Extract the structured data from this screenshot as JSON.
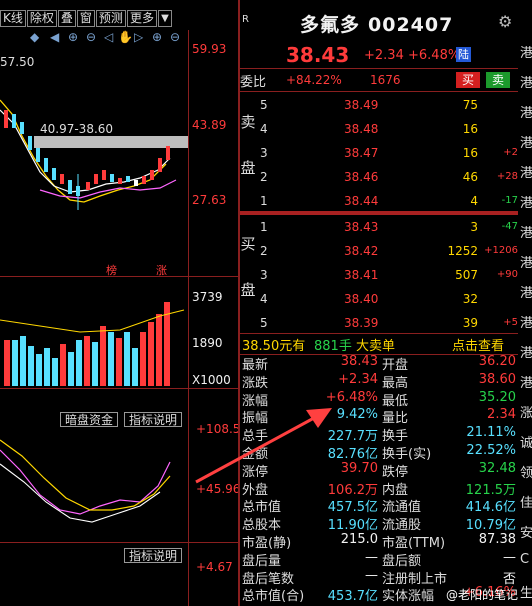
{
  "toolbar": {
    "tabs": [
      "K线",
      "除权",
      "叠",
      "窗",
      "预测",
      "更多"
    ],
    "dropdown": "▼"
  },
  "chart": {
    "price_label_top": "57.50",
    "range_note": "40.97-38.60",
    "axis_labels": [
      "59.93",
      "43.89",
      "27.63",
      "3739",
      "1890",
      "X1000",
      "+108.5",
      "+45.96",
      "+4.67"
    ],
    "tags": [
      "榜",
      "涨"
    ],
    "btn_dark_pool": "暗盘资金",
    "btn_indicator": "指标说明",
    "btn_indicator2": "指标说明"
  },
  "stock": {
    "logo": "R",
    "name": "多氟多",
    "code": "002407",
    "price": "38.43",
    "change": "+2.34",
    "change_pct": "+6.48%",
    "exchange_badge": "陆"
  },
  "weibi": {
    "label": "委比",
    "ratio": "+84.22%",
    "diff": "1676",
    "buy_btn": "买",
    "sell_btn": "卖"
  },
  "order_book": {
    "sell_label": [
      "卖",
      "盘"
    ],
    "buy_label": [
      "买",
      "盘"
    ],
    "asks": [
      {
        "level": "5",
        "price": "38.49",
        "vol": "75",
        "delta": ""
      },
      {
        "level": "4",
        "price": "38.48",
        "vol": "16",
        "delta": ""
      },
      {
        "level": "3",
        "price": "38.47",
        "vol": "16",
        "delta": "+2"
      },
      {
        "level": "2",
        "price": "38.46",
        "vol": "46",
        "delta": "+28"
      },
      {
        "level": "1",
        "price": "38.44",
        "vol": "4",
        "delta": "-17"
      }
    ],
    "bids": [
      {
        "level": "1",
        "price": "38.43",
        "vol": "3",
        "delta": "-47"
      },
      {
        "level": "2",
        "price": "38.42",
        "vol": "1252",
        "delta": "+1206"
      },
      {
        "level": "3",
        "price": "38.41",
        "vol": "507",
        "delta": "+90"
      },
      {
        "level": "4",
        "price": "38.40",
        "vol": "32",
        "delta": ""
      },
      {
        "level": "5",
        "price": "38.39",
        "vol": "39",
        "delta": "+5"
      }
    ]
  },
  "big_trade": {
    "price": "38.50元有",
    "hands": "881手",
    "text": "大卖单",
    "link": "点击查看"
  },
  "stats": [
    {
      "l1": "最新",
      "v1": "38.43",
      "c1": "red",
      "l2": "开盘",
      "v2": "36.20",
      "c2": "red"
    },
    {
      "l1": "涨跌",
      "v1": "+2.34",
      "c1": "red",
      "l2": "最高",
      "v2": "38.60",
      "c2": "red"
    },
    {
      "l1": "涨幅",
      "v1": "+6.48%",
      "c1": "red",
      "l2": "最低",
      "v2": "35.20",
      "c2": "green"
    },
    {
      "l1": "振幅",
      "v1": "9.42%",
      "c1": "cyan",
      "l2": "量比",
      "v2": "2.34",
      "c2": "red"
    },
    {
      "l1": "总手",
      "v1": "227.7万",
      "c1": "cyan",
      "l2": "换手",
      "v2": "21.11%",
      "c2": "cyan"
    },
    {
      "l1": "金额",
      "v1": "82.76亿",
      "c1": "cyan",
      "l2": "换手(实)",
      "v2": "22.52%",
      "c2": "cyan"
    },
    {
      "l1": "涨停",
      "v1": "39.70",
      "c1": "red",
      "l2": "跌停",
      "v2": "32.48",
      "c2": "green"
    },
    {
      "l1": "外盘",
      "v1": "106.2万",
      "c1": "red",
      "l2": "内盘",
      "v2": "121.5万",
      "c2": "green"
    },
    {
      "l1": "总市值",
      "v1": "457.5亿",
      "c1": "cyan",
      "l2": "流通值",
      "v2": "414.6亿",
      "c2": "cyan"
    },
    {
      "l1": "总股本",
      "v1": "11.90亿",
      "c1": "cyan",
      "l2": "流通股",
      "v2": "10.79亿",
      "c2": "cyan"
    },
    {
      "l1": "市盈(静)",
      "v1": "215.0",
      "c1": "white",
      "l2": "市盈(TTM)",
      "v2": "87.38",
      "c2": "white"
    },
    {
      "l1": "盘后量",
      "v1": "—",
      "c1": "white",
      "l2": "盘后额",
      "v2": "—",
      "c2": "white"
    },
    {
      "l1": "盘后笔数",
      "v1": "—",
      "c1": "white",
      "l2": "注册制上市",
      "v2": "否",
      "c2": "white"
    },
    {
      "l1": "总市值(合)",
      "v1": "453.7亿",
      "c1": "cyan",
      "l2": "实体涨幅",
      "v2": "+6.16%",
      "c2": "red"
    }
  ],
  "far_right": [
    "港",
    "港",
    "港",
    "港",
    "港",
    "港",
    "港",
    "港",
    "港",
    "港",
    "港",
    "港",
    "涨",
    "诚",
    "领",
    "佳",
    "安",
    "C",
    "生"
  ],
  "watermark": "@老阳的笔记",
  "colors": {
    "up": "#ff3b3b",
    "down": "#27d34b",
    "accent": "#ffd700",
    "info": "#58e0ff"
  }
}
